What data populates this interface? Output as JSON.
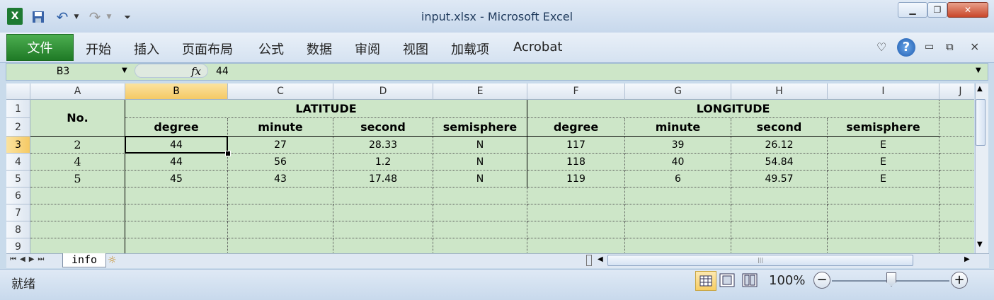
{
  "window": {
    "title": "input.xlsx - Microsoft Excel",
    "minimize": "▁",
    "restore": "❐",
    "close": "✕"
  },
  "ribbon": {
    "file_tab": "文件",
    "tabs": [
      "开始",
      "插入",
      "页面布局",
      "公式",
      "数据",
      "审阅",
      "视图",
      "加载项",
      "Acrobat"
    ]
  },
  "formula_bar": {
    "name_box": "B3",
    "fx": "fx",
    "value": "44"
  },
  "columns": [
    "A",
    "B",
    "C",
    "D",
    "E",
    "F",
    "G",
    "H",
    "I",
    "J"
  ],
  "rows": [
    "1",
    "2",
    "3",
    "4",
    "5",
    "6",
    "7",
    "8",
    "9"
  ],
  "sheet": {
    "a_header": "No.",
    "latitude": "LATITUDE",
    "longitude": "LONGITUDE",
    "subheaders": [
      "degree",
      "minute",
      "second",
      "semisphere",
      "degree",
      "minute",
      "second",
      "semisphere"
    ],
    "data": [
      [
        "2",
        "44",
        "27",
        "28.33",
        "N",
        "117",
        "39",
        "26.12",
        "E"
      ],
      [
        "4",
        "44",
        "56",
        "1.2",
        "N",
        "118",
        "40",
        "54.84",
        "E"
      ],
      [
        "5",
        "45",
        "43",
        "17.48",
        "N",
        "119",
        "6",
        "49.57",
        "E"
      ]
    ]
  },
  "sheet_tabs": [
    "info"
  ],
  "status": {
    "ready": "就绪",
    "zoom": "100%",
    "zoom_minus": "−",
    "zoom_plus": "+"
  }
}
